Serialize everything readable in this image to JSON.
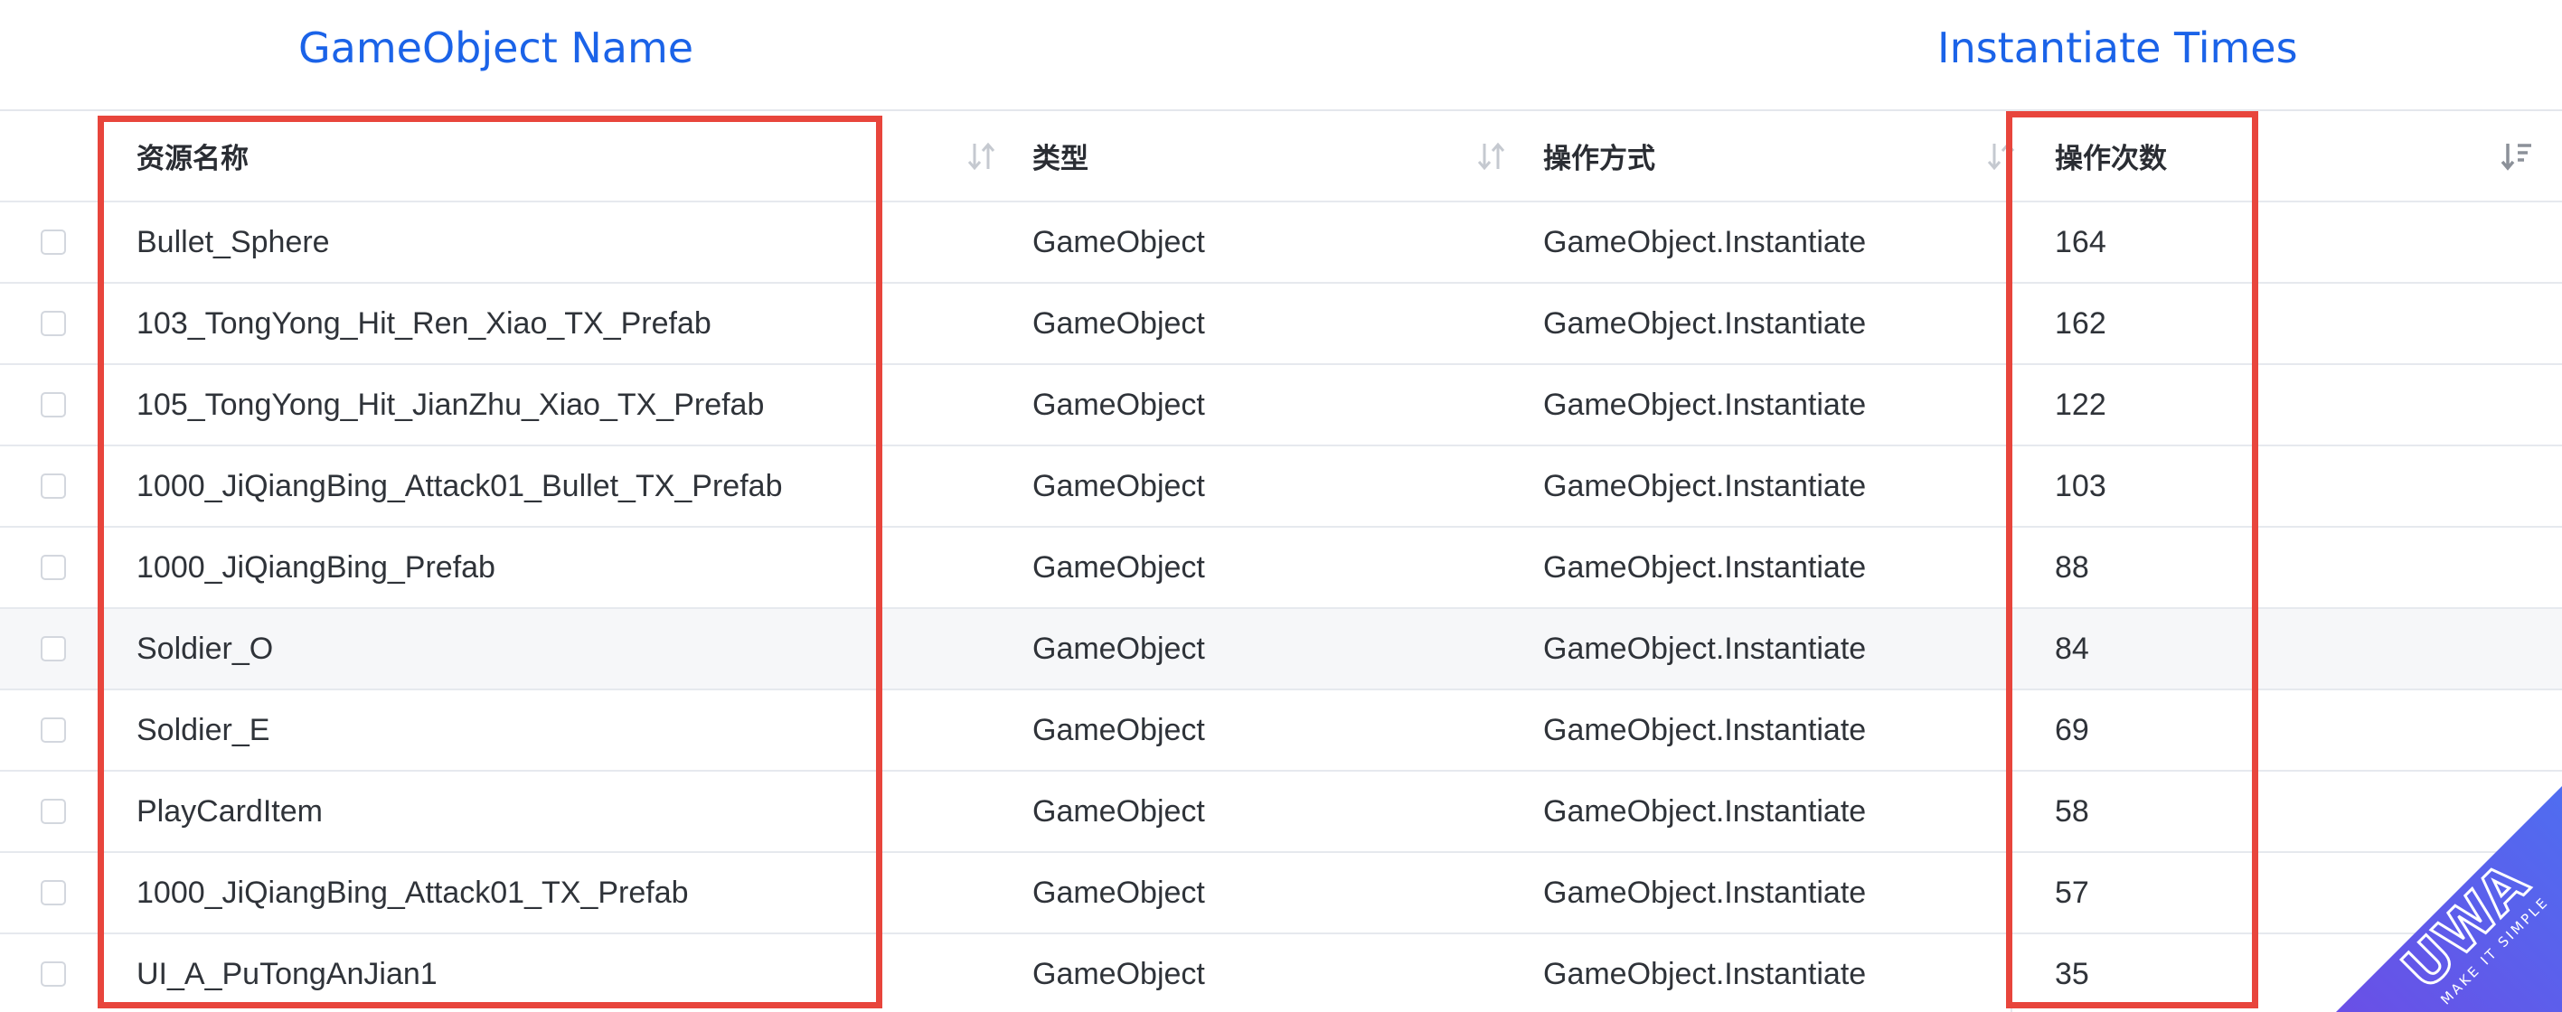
{
  "annotations": {
    "name_label": "GameObject Name",
    "times_label": "Instantiate Times"
  },
  "table": {
    "headers": {
      "name": "资源名称",
      "type": "类型",
      "operation": "操作方式",
      "count": "操作次数"
    },
    "rows": [
      {
        "name": "Bullet_Sphere",
        "type": "GameObject",
        "operation": "GameObject.Instantiate",
        "count": "164"
      },
      {
        "name": "103_TongYong_Hit_Ren_Xiao_TX_Prefab",
        "type": "GameObject",
        "operation": "GameObject.Instantiate",
        "count": "162"
      },
      {
        "name": "105_TongYong_Hit_JianZhu_Xiao_TX_Prefab",
        "type": "GameObject",
        "operation": "GameObject.Instantiate",
        "count": "122"
      },
      {
        "name": "1000_JiQiangBing_Attack01_Bullet_TX_Prefab",
        "type": "GameObject",
        "operation": "GameObject.Instantiate",
        "count": "103"
      },
      {
        "name": "1000_JiQiangBing_Prefab",
        "type": "GameObject",
        "operation": "GameObject.Instantiate",
        "count": "88"
      },
      {
        "name": "Soldier_O",
        "type": "GameObject",
        "operation": "GameObject.Instantiate",
        "count": "84"
      },
      {
        "name": "Soldier_E",
        "type": "GameObject",
        "operation": "GameObject.Instantiate",
        "count": "69"
      },
      {
        "name": "PlayCardItem",
        "type": "GameObject",
        "operation": "GameObject.Instantiate",
        "count": "58"
      },
      {
        "name": "1000_JiQiangBing_Attack01_TX_Prefab",
        "type": "GameObject",
        "operation": "GameObject.Instantiate",
        "count": "57"
      },
      {
        "name": "UI_A_PuTongAnJian1",
        "type": "GameObject",
        "operation": "GameObject.Instantiate",
        "count": "35"
      }
    ],
    "highlighted_row": 5
  },
  "watermark": {
    "brand": "UWA",
    "tagline": "MAKE IT SIMPLE",
    "color": "#5b55e6"
  },
  "colors": {
    "annotation_text": "#1b63e8",
    "highlight_border": "#e8453c",
    "row_divider": "#e6e9ee",
    "alt_row_bg": "#f6f7f9"
  },
  "icons": {
    "sort_default": "sort-icon",
    "sort_desc": "sort-descending-icon",
    "row_select": "checkbox-icon"
  }
}
